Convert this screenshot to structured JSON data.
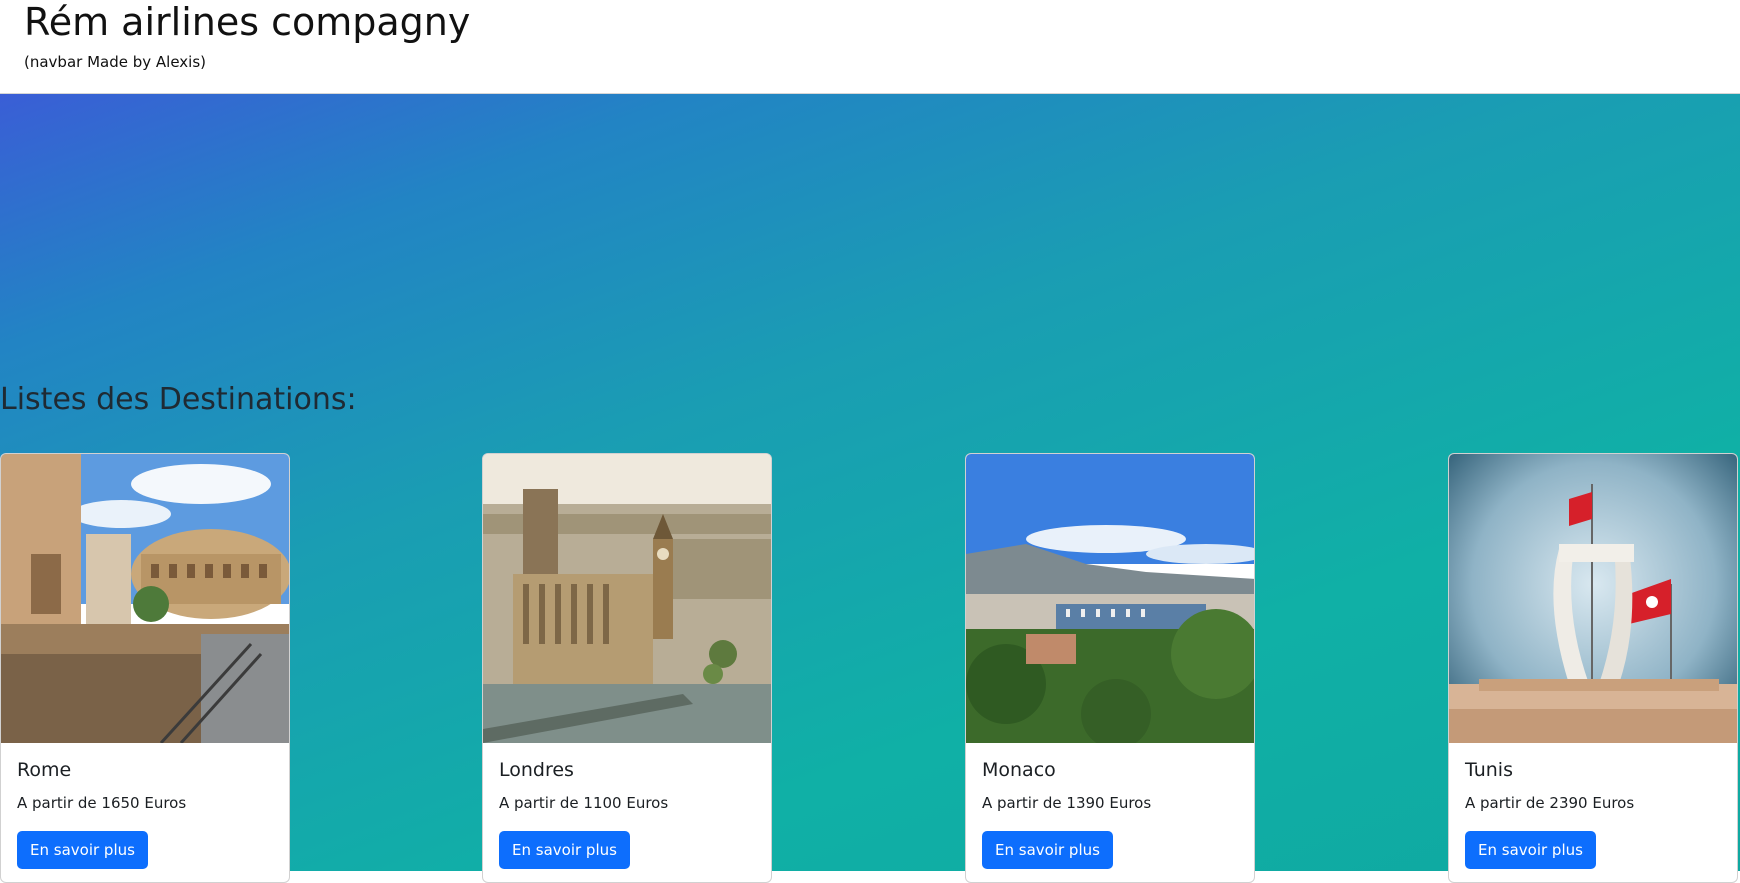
{
  "navbar": {
    "brand": "Rém airlines compagny",
    "subtitle": "(navbar Made by Alexis)"
  },
  "section": {
    "title": "Listes des Destinations:"
  },
  "destinations": [
    {
      "name": "Rome",
      "price_text": "A partir de 1650 Euros",
      "button_label": "En savoir plus",
      "image": "colosseum-photo"
    },
    {
      "name": "Londres",
      "price_text": "A partir de 1100 Euros",
      "button_label": "En savoir plus",
      "image": "westminster-photo"
    },
    {
      "name": "Monaco",
      "price_text": "A partir de 1390 Euros",
      "button_label": "En savoir plus",
      "image": "monaco-harbor-photo"
    },
    {
      "name": "Tunis",
      "price_text": "A partir de 2390 Euros",
      "button_label": "En savoir plus",
      "image": "tunis-monument-photo"
    }
  ],
  "colors": {
    "button": "#0d6efd",
    "hero_gradient_start": "#3a5ed6",
    "hero_gradient_end": "#10b0a6"
  }
}
